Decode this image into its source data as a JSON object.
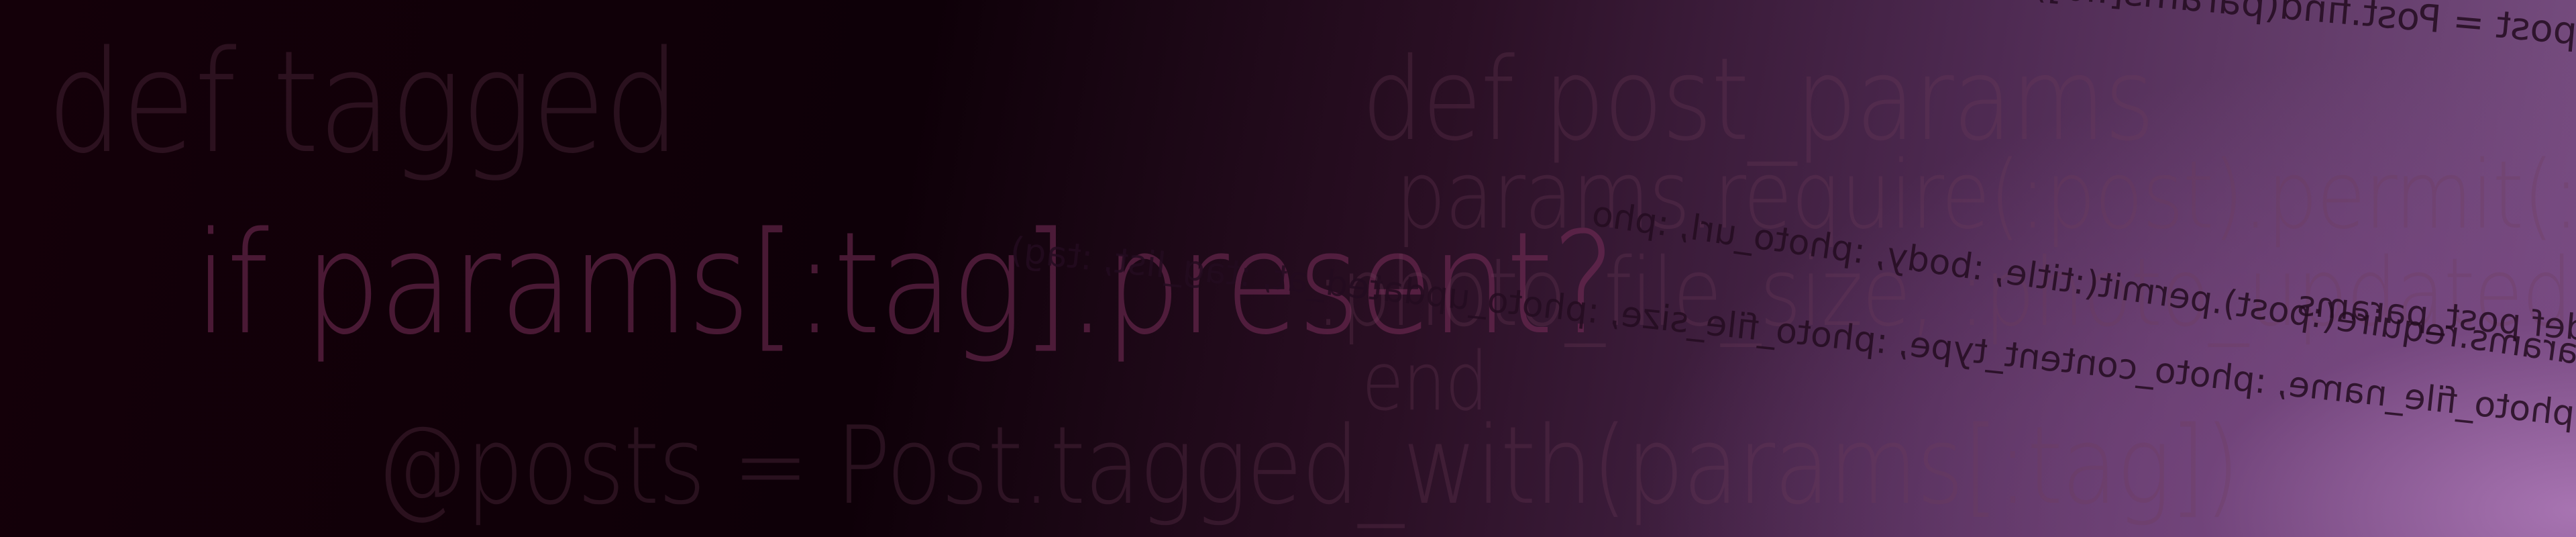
{
  "background": {
    "dark": "#0e0008",
    "light": "#a36fae"
  },
  "code_large": [
    "def tagged",
    "if params[:tag].present?",
    "@posts = Post.tagged_with(params[:tag])",
    "def post_params",
    "params.require(:post).permit(:title",
    ":photo_file_size, :photo_updated_at",
    "end"
  ],
  "code_mirrored": [
    "@post = Post.find(params[:id])",
    "def post_params",
    "params.require(:post).permit(:title, :body, :photo_url, :pho",
    "url, :photo_file_name, :photo_content_type, :photo_file_size, :photo_updated_at, :tag_list, :tag)"
  ]
}
